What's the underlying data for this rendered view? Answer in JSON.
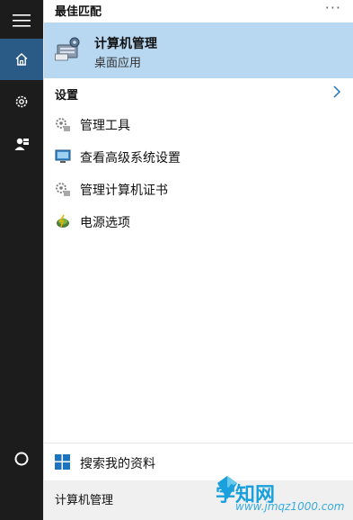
{
  "best_match": {
    "header": "最佳匹配",
    "more_label": "···",
    "title": "计算机管理",
    "subtitle": "桌面应用"
  },
  "settings": {
    "label": "设置",
    "items": [
      {
        "label": "管理工具",
        "icon": "admin-tools-icon"
      },
      {
        "label": "查看高级系统设置",
        "icon": "monitor-icon"
      },
      {
        "label": "管理计算机证书",
        "icon": "certificate-tools-icon"
      },
      {
        "label": "电源选项",
        "icon": "power-options-icon"
      }
    ]
  },
  "search_my_stuff": {
    "label": "搜索我的资料",
    "icon": "windows-icon"
  },
  "search_box": {
    "value": "计算机管理"
  },
  "watermark": {
    "text": "学知网",
    "url": "www.jmqz1000.com"
  },
  "colors": {
    "rail_bg": "#1c1c1c",
    "rail_active": "#2a5b86",
    "highlight": "#b8d7f1",
    "accent": "#1e73be"
  }
}
